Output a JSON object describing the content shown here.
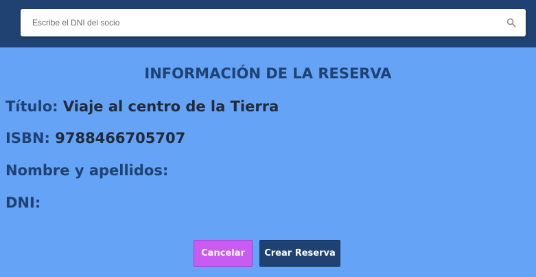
{
  "search": {
    "placeholder": "Escribe el DNI del socio",
    "value": ""
  },
  "reservation": {
    "heading": "INFORMACIÓN DE LA RESERVA",
    "fields": [
      {
        "label": "Título:",
        "value": "Viaje al centro de la Tierra"
      },
      {
        "label": "ISBN:",
        "value": "9788466705707"
      },
      {
        "label": "Nombre y apellidos:",
        "value": ""
      },
      {
        "label": "DNI:",
        "value": ""
      }
    ]
  },
  "actions": {
    "cancel_label": "Cancelar",
    "create_label": "Crear Reserva"
  },
  "colors": {
    "background": "#64a3f6",
    "header": "#1f4272",
    "cancel_button": "#c95af2",
    "create_button": "#1f4272"
  }
}
